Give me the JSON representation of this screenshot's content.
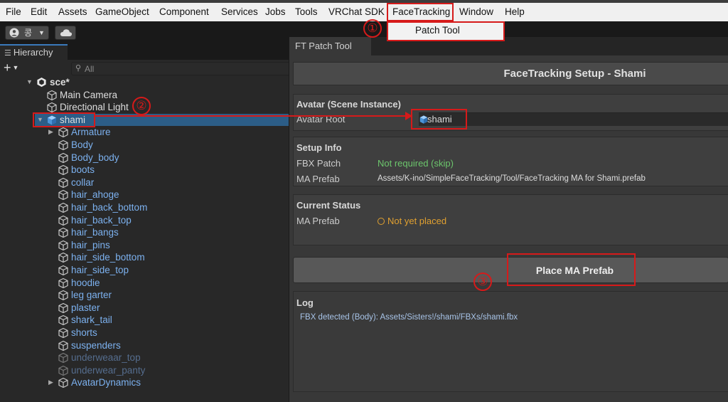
{
  "menubar": {
    "items": [
      "File",
      "Edit",
      "Assets",
      "GameObject",
      "Component",
      "Services",
      "Jobs",
      "Tools",
      "VRChat SDK",
      "FaceTracking",
      "Window",
      "Help"
    ]
  },
  "dropdown": {
    "item": "Patch Tool"
  },
  "toolbar": {
    "account_label": "콩"
  },
  "hierarchy": {
    "tab_label": "Hierarchy",
    "search_placeholder": "All",
    "scene_name": "sce*",
    "rows": [
      {
        "label": "Main Camera",
        "color": "white"
      },
      {
        "label": "Directional Light",
        "color": "white"
      },
      {
        "label": "shami",
        "color": "white",
        "selected": true,
        "expanded": true
      },
      {
        "label": "Armature",
        "color": "blue",
        "collapsed": true
      },
      {
        "label": "Body",
        "color": "blue"
      },
      {
        "label": "Body_body",
        "color": "blue"
      },
      {
        "label": "boots",
        "color": "blue"
      },
      {
        "label": "collar",
        "color": "blue"
      },
      {
        "label": "hair_ahoge",
        "color": "blue"
      },
      {
        "label": "hair_back_bottom",
        "color": "blue"
      },
      {
        "label": "hair_back_top",
        "color": "blue"
      },
      {
        "label": "hair_bangs",
        "color": "blue"
      },
      {
        "label": "hair_pins",
        "color": "blue"
      },
      {
        "label": "hair_side_bottom",
        "color": "blue"
      },
      {
        "label": "hair_side_top",
        "color": "blue"
      },
      {
        "label": "hoodie",
        "color": "blue"
      },
      {
        "label": "leg garter",
        "color": "blue"
      },
      {
        "label": "plaster",
        "color": "blue"
      },
      {
        "label": "shark_tail",
        "color": "blue"
      },
      {
        "label": "shorts",
        "color": "blue"
      },
      {
        "label": "suspenders",
        "color": "blue"
      },
      {
        "label": "underweaar_top",
        "color": "dim"
      },
      {
        "label": "underwear_panty",
        "color": "dim"
      },
      {
        "label": "AvatarDynamics",
        "color": "blue",
        "collapsed": true
      }
    ]
  },
  "ftwindow": {
    "tab_label": "FT Patch Tool",
    "header": "FaceTracking Setup - Shami",
    "avatar_group": {
      "title": "Avatar (Scene Instance)",
      "root_label": "Avatar Root",
      "root_value": "shami"
    },
    "setup_group": {
      "title": "Setup Info",
      "fbx_label": "FBX Patch",
      "fbx_value": "Not required (skip)",
      "ma_label": "MA Prefab",
      "ma_value": "Assets/K-ino/SimpleFaceTracking/Tool/FaceTracking MA for Shami.prefab"
    },
    "status_group": {
      "title": "Current Status",
      "ma_label": "MA Prefab",
      "ma_value": "Not yet placed"
    },
    "place_button": "Place MA Prefab",
    "log_group": {
      "title": "Log",
      "entry": "FBX detected (Body): Assets/Sisters!/shami/FBXs/shami.fbx"
    }
  },
  "annotations": {
    "badge1": "①",
    "badge2": "②",
    "badge3": "③"
  },
  "colors": {
    "accent_red": "#d61a1a",
    "ok_green": "#6cc66c",
    "warn_orange": "#e0a030",
    "link_blue": "#7cb1ef"
  }
}
